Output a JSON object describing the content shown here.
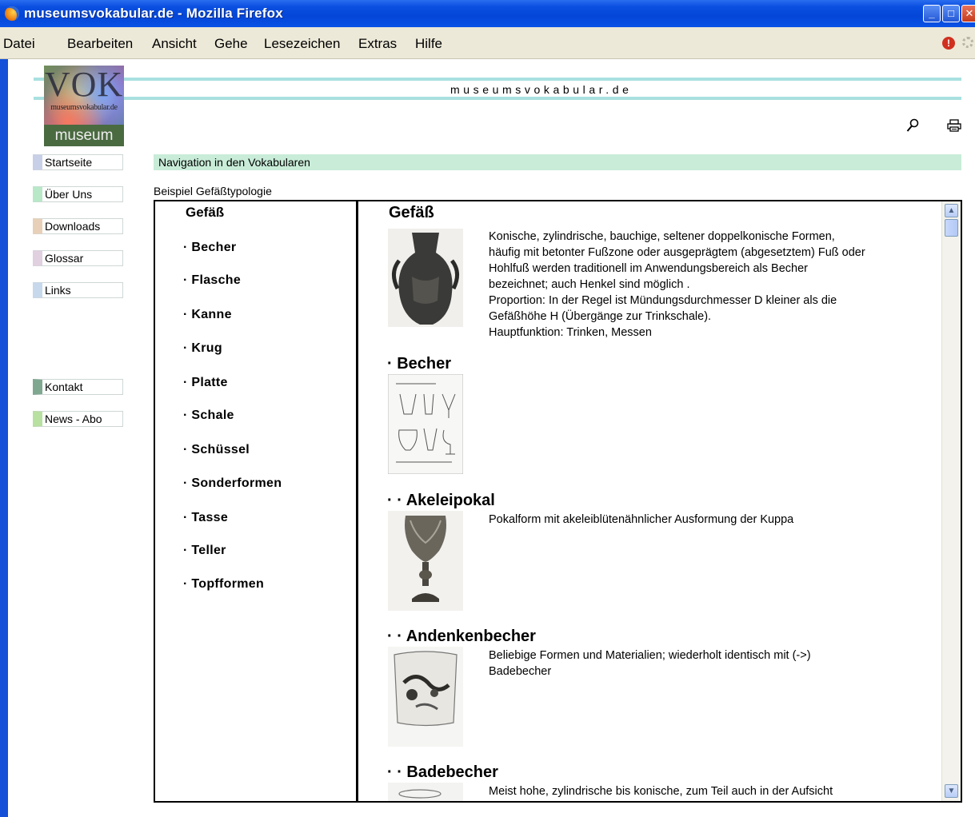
{
  "window": {
    "title": "museumsvokabular.de - Mozilla Firefox"
  },
  "menu": [
    "Datei",
    "Bearbeiten",
    "Ansicht",
    "Gehe",
    "Lesezeichen",
    "Extras",
    "Hilfe"
  ],
  "logo": {
    "big": "VOK",
    "small": "museumsvokabular.de",
    "bottom": "museum"
  },
  "site_title": "museumsvokabular.de",
  "nav": {
    "items": [
      "Startseite",
      "Über Uns",
      "Downloads",
      "Glossar",
      "Links"
    ],
    "items2": [
      "Kontakt",
      "News - Abo"
    ],
    "colors": [
      "#c8d0e8",
      "#b8e8c8",
      "#e8d0b8",
      "#e0d0e0",
      "#c8d8ec",
      "#80a890",
      "#b8e0a0"
    ]
  },
  "navbar": "Navigation in den Vokabularen",
  "example_label": "Beispiel Gefäßtypologie",
  "tree": {
    "head": "Gefäß",
    "items": [
      "· Becher",
      "· Flasche",
      "· Kanne",
      "· Krug",
      "· Platte",
      "· Schale",
      "· Schüssel",
      "· Sonderformen",
      "· Tasse",
      "· Teller",
      "· Topfformen"
    ]
  },
  "content": {
    "gefaess": {
      "title": "Gefäß",
      "lines": [
        "Konische, zylindrische, bauchige, seltener doppelkonische Formen,",
        "häufig mit betonter Fußzone oder ausgeprägtem (abgesetztem) Fuß oder",
        "Hohlfuß werden traditionell im Anwendungsbereich als Becher",
        "bezeichnet; auch Henkel sind möglich .",
        "Proportion: In der Regel ist Mündungsdurchmesser D kleiner als die",
        "Gefäßhöhe H (Übergänge zur Trinkschale).",
        "Hauptfunktion: Trinken, Messen"
      ]
    },
    "becher": {
      "title": "· Becher"
    },
    "akeleipokal": {
      "title": "· · Akeleipokal",
      "lines": [
        "Pokalform mit akeleiblütenähnlicher Ausformung der Kuppa"
      ]
    },
    "andenkenbecher": {
      "title": "· · Andenkenbecher",
      "lines": [
        "Beliebige Formen und Materialien; wiederholt identisch mit (->)",
        "Badebecher"
      ]
    },
    "badebecher": {
      "title": "· · Badebecher",
      "lines": [
        "Meist hohe, zylindrische bis konische, zum Teil auch in der Aufsicht"
      ]
    }
  }
}
